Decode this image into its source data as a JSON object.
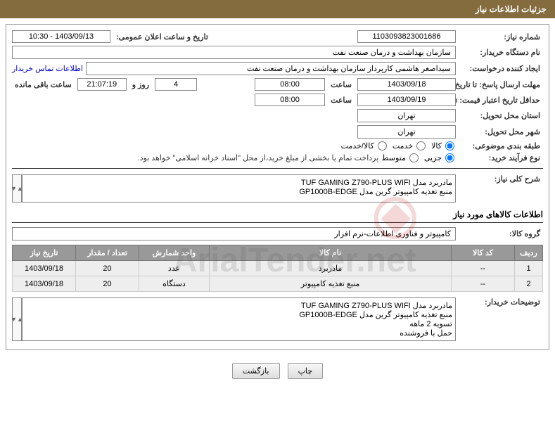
{
  "header": {
    "title": "جزئیات اطلاعات نیاز"
  },
  "fields": {
    "need_no_label": "شماره نیاز:",
    "need_no": "1103093823001686",
    "announce_dt_label": "تاریخ و ساعت اعلان عمومی:",
    "announce_dt": "1403/09/13 - 10:30",
    "buyer_org_label": "نام دستگاه خریدار:",
    "buyer_org": "سازمان بهداشت و درمان صنعت نفت",
    "requester_label": "ایجاد کننده درخواست:",
    "requester": "سیداصغر هاشمی کارپرداز سازمان بهداشت و درمان صنعت نفت",
    "contact_link": "اطلاعات تماس خریدار",
    "deadline_send_label": "مهلت ارسال پاسخ: تا تاریخ:",
    "deadline_send_date": "1403/09/18",
    "time_label": "ساعت",
    "deadline_send_time": "08:00",
    "days_and": "روز و",
    "days_value": "4",
    "countdown": "21:07:19",
    "remaining_label": "ساعت باقی مانده",
    "validity_label": "حداقل تاریخ اعتبار قیمت: تا تاریخ:",
    "validity_date": "1403/09/19",
    "validity_time": "08:00",
    "province_label": "استان محل تحویل:",
    "province": "تهران",
    "city_label": "شهر محل تحویل:",
    "city": "تهران",
    "category_label": "طبقه بندی موضوعی:",
    "cat_goods": "کالا",
    "cat_service": "خدمت",
    "cat_goodsservice": "کالا/خدمت",
    "buy_type_label": "نوع فرآیند خرید:",
    "buy_small": "جزیی",
    "buy_medium": "متوسط",
    "buy_note": "پرداخت تمام یا بخشی از مبلغ خرید،از محل \"اسناد خزانه اسلامی\" خواهد بود.",
    "general_desc_label": "شرح کلی نیاز:",
    "general_desc": "مادربرد مدل TUF GAMING Z790-PLUS WIFI\nمنبع تغذیه کامپیوتر گرین مدل GP1000B-EDGE",
    "goods_info_title": "اطلاعات کالاهای مورد نیاز",
    "goods_group_label": "گروه کالا:",
    "goods_group": "کامپیوتر و فناوری اطلاعات-نرم افزار",
    "buyer_notes_label": "توضیحات خریدار:",
    "buyer_notes": "مادربرد مدل TUF GAMING Z790-PLUS WIFI\nمنبع تغذیه کامپیوتر گرین مدل GP1000B-EDGE\nتسویه 2 ماهه\nحمل با فروشنده"
  },
  "table": {
    "headers": {
      "row": "ردیف",
      "code": "کد کالا",
      "name": "نام کالا",
      "unit": "واحد شمارش",
      "qty": "تعداد / مقدار",
      "date": "تاریخ نیاز"
    },
    "rows": [
      {
        "row": "1",
        "code": "--",
        "name": "مادربرد",
        "unit": "عدد",
        "qty": "20",
        "date": "1403/09/18"
      },
      {
        "row": "2",
        "code": "--",
        "name": "منبع تغذیه کامپیوتر",
        "unit": "دستگاه",
        "qty": "20",
        "date": "1403/09/18"
      }
    ]
  },
  "buttons": {
    "print": "چاپ",
    "back": "بازگشت"
  },
  "watermark": "ArialTender.net"
}
